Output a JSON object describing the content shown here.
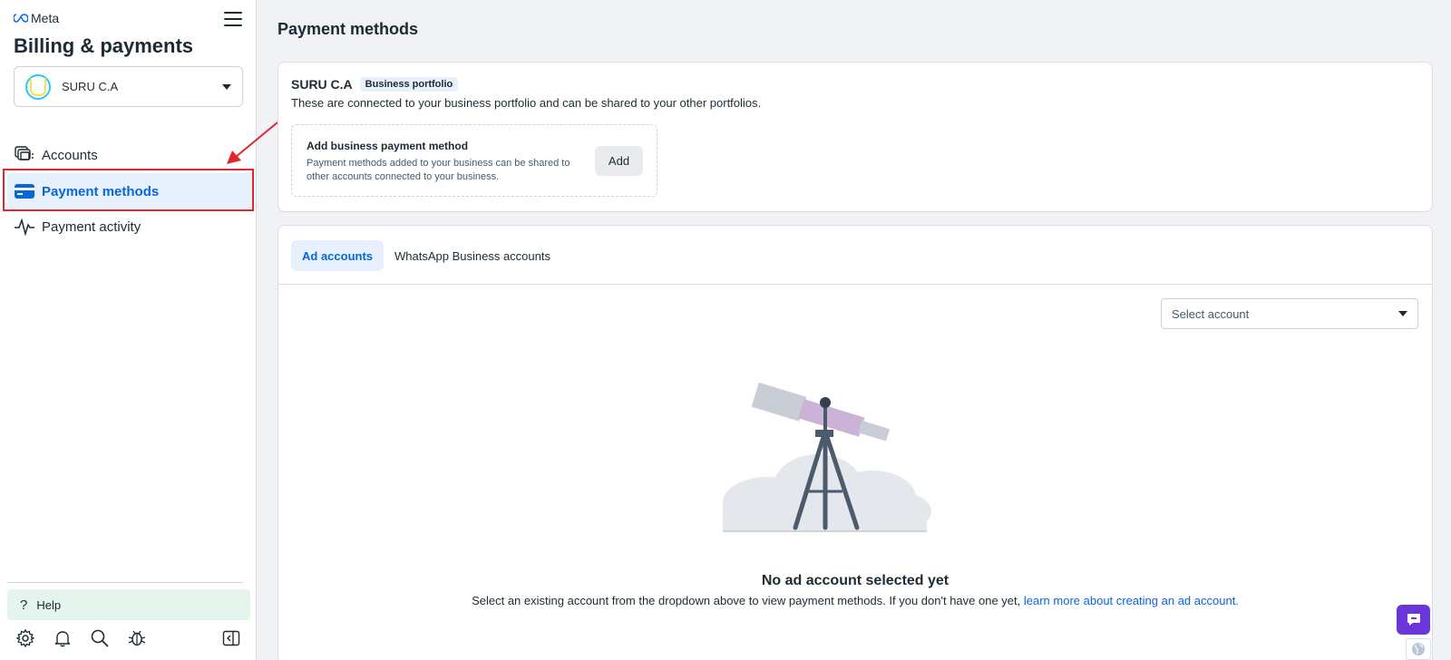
{
  "app": {
    "brand": "Meta",
    "title": "Billing & payments"
  },
  "portfolio_selector": {
    "name": "SURU C.A"
  },
  "sidebar": {
    "items": [
      {
        "label": "Accounts",
        "icon": "accounts-icon",
        "active": false
      },
      {
        "label": "Payment methods",
        "icon": "credit-card-icon",
        "active": true
      },
      {
        "label": "Payment activity",
        "icon": "activity-icon",
        "active": false
      }
    ],
    "help_label": "Help",
    "footer_icons": [
      "settings-icon",
      "bell-icon",
      "search-icon",
      "bug-icon",
      "collapse-panel-icon"
    ]
  },
  "main": {
    "page_title": "Payment methods",
    "portfolio": {
      "name": "SURU C.A",
      "badge": "Business portfolio",
      "description": "These are connected to your business portfolio and can be shared to your other portfolios."
    },
    "add_method": {
      "title": "Add business payment method",
      "description": "Payment methods added to your business can be shared to other accounts connected to your business.",
      "button": "Add"
    },
    "tabs": [
      {
        "label": "Ad accounts",
        "active": true
      },
      {
        "label": "WhatsApp Business accounts",
        "active": false
      }
    ],
    "select_account_placeholder": "Select account",
    "empty_state": {
      "title": "No ad account selected yet",
      "description": "Select an existing account from the dropdown above to view payment methods. If you don't have one yet, ",
      "link": "learn more about creating an ad account."
    }
  },
  "colors": {
    "accent": "#0a66d8",
    "active_bg": "#e7f0fd",
    "annotation_red": "#e0272a",
    "chat_purple": "#6a36d9"
  }
}
